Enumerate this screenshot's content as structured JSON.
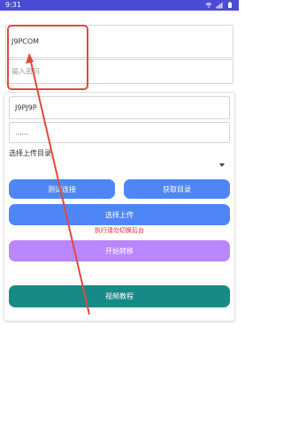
{
  "status_bar": {
    "time": "9:31",
    "icons": [
      "wifi-icon",
      "signal-icon",
      "battery-icon"
    ],
    "background": "#4b4bd6",
    "text_color": "#ffffff"
  },
  "top_form": {
    "server_input": {
      "value": "J9PCOM",
      "placeholder": ""
    },
    "password_input": {
      "value": "",
      "placeholder": "输入密码"
    }
  },
  "card": {
    "username_input": {
      "value": "J9PJ9P",
      "placeholder": ""
    },
    "password_input": {
      "value": "......",
      "placeholder": ""
    },
    "directory_label": "选择上传目录",
    "dropdown": {
      "selected": ""
    },
    "test_button": "测试连接",
    "fetch_button": "获取目录",
    "upload_button": "选择上传",
    "hint": "执行请勿切换后台",
    "transfer_button": "开始转移",
    "tutorial_button": "视频教程"
  },
  "colors": {
    "blue_button": "#4f86f7",
    "purple_button": "#b987ff",
    "teal_button": "#168a87",
    "hint_text": "#e52727",
    "annotation": "#e04a3a"
  }
}
